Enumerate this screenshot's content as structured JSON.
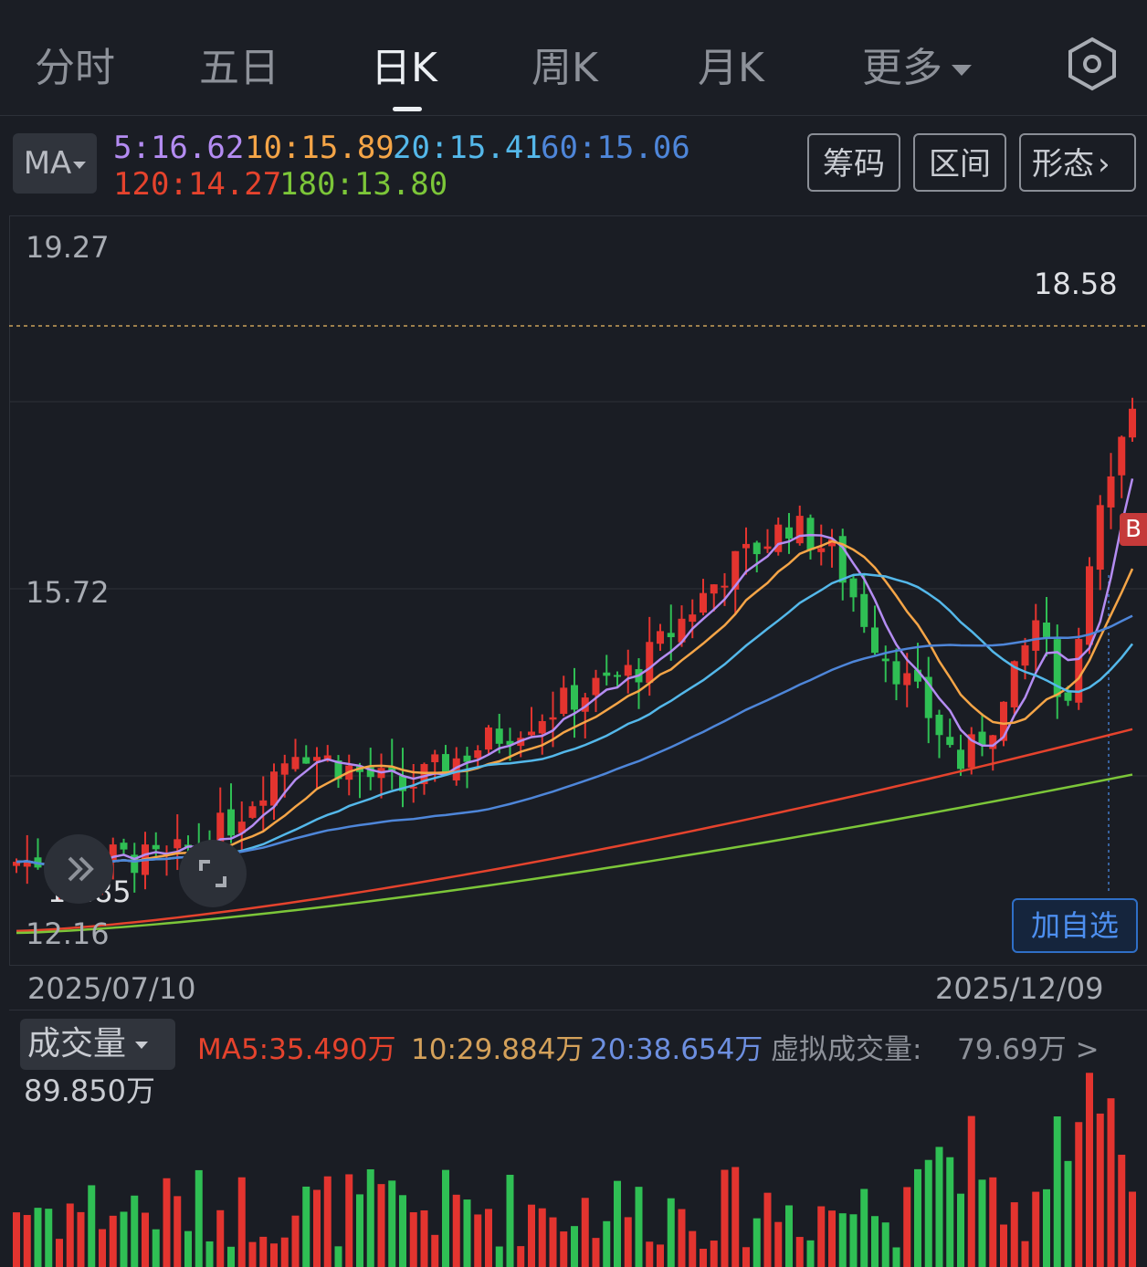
{
  "tabs": [
    {
      "label": "分时"
    },
    {
      "label": "五日"
    },
    {
      "label": "日K"
    },
    {
      "label": "周K"
    },
    {
      "label": "月K"
    },
    {
      "label": "更多"
    }
  ],
  "indicator": {
    "selected": "MA"
  },
  "ma_labels": {
    "ma5": "5:16.62",
    "ma10": "10:15.89",
    "ma20": "20:15.41",
    "ma60": "60:15.06",
    "ma120": "120:14.27",
    "ma180": "180:13.80"
  },
  "colors": {
    "ma5": "#b48cf2",
    "ma10": "#f5a547",
    "ma20": "#54b8ea",
    "ma60": "#4e86d9",
    "ma120": "#e5432d",
    "ma180": "#7cc639",
    "up": "#e3342f",
    "down": "#2fbf54",
    "background": "#1a1d24"
  },
  "buttons": {
    "chips": "筹码",
    "interval": "区间",
    "pattern": "形态"
  },
  "axis": {
    "top": "19.27",
    "mid": "15.72",
    "bottom": "12.16",
    "high_marker": "18.58",
    "low_marker": "12.85"
  },
  "dates": {
    "start": "2025/07/10",
    "end": "2025/12/09"
  },
  "add_watchlist": "加自选",
  "buy_marker": "B",
  "volume": {
    "selector": "成交量",
    "ma5": "MA5:35.490万",
    "ma10": "10:29.884万",
    "ma20": "20:38.654万",
    "virtual_label": "虚拟成交量:",
    "virtual_value": "79.69万 >",
    "max": "89.850万"
  },
  "chart_data": {
    "type": "candlestick",
    "y_range": [
      12.16,
      19.27
    ],
    "x_range": [
      "2025/07/10",
      "2025/12/09"
    ],
    "moving_averages": [
      {
        "name": "MA5",
        "value": 16.62
      },
      {
        "name": "MA10",
        "value": 15.89
      },
      {
        "name": "MA20",
        "value": 15.41
      },
      {
        "name": "MA60",
        "value": 15.06
      },
      {
        "name": "MA120",
        "value": 14.27
      },
      {
        "name": "MA180",
        "value": 13.8
      }
    ],
    "period_high": 18.58,
    "period_low": 12.85,
    "volume_max": "89.850万"
  }
}
